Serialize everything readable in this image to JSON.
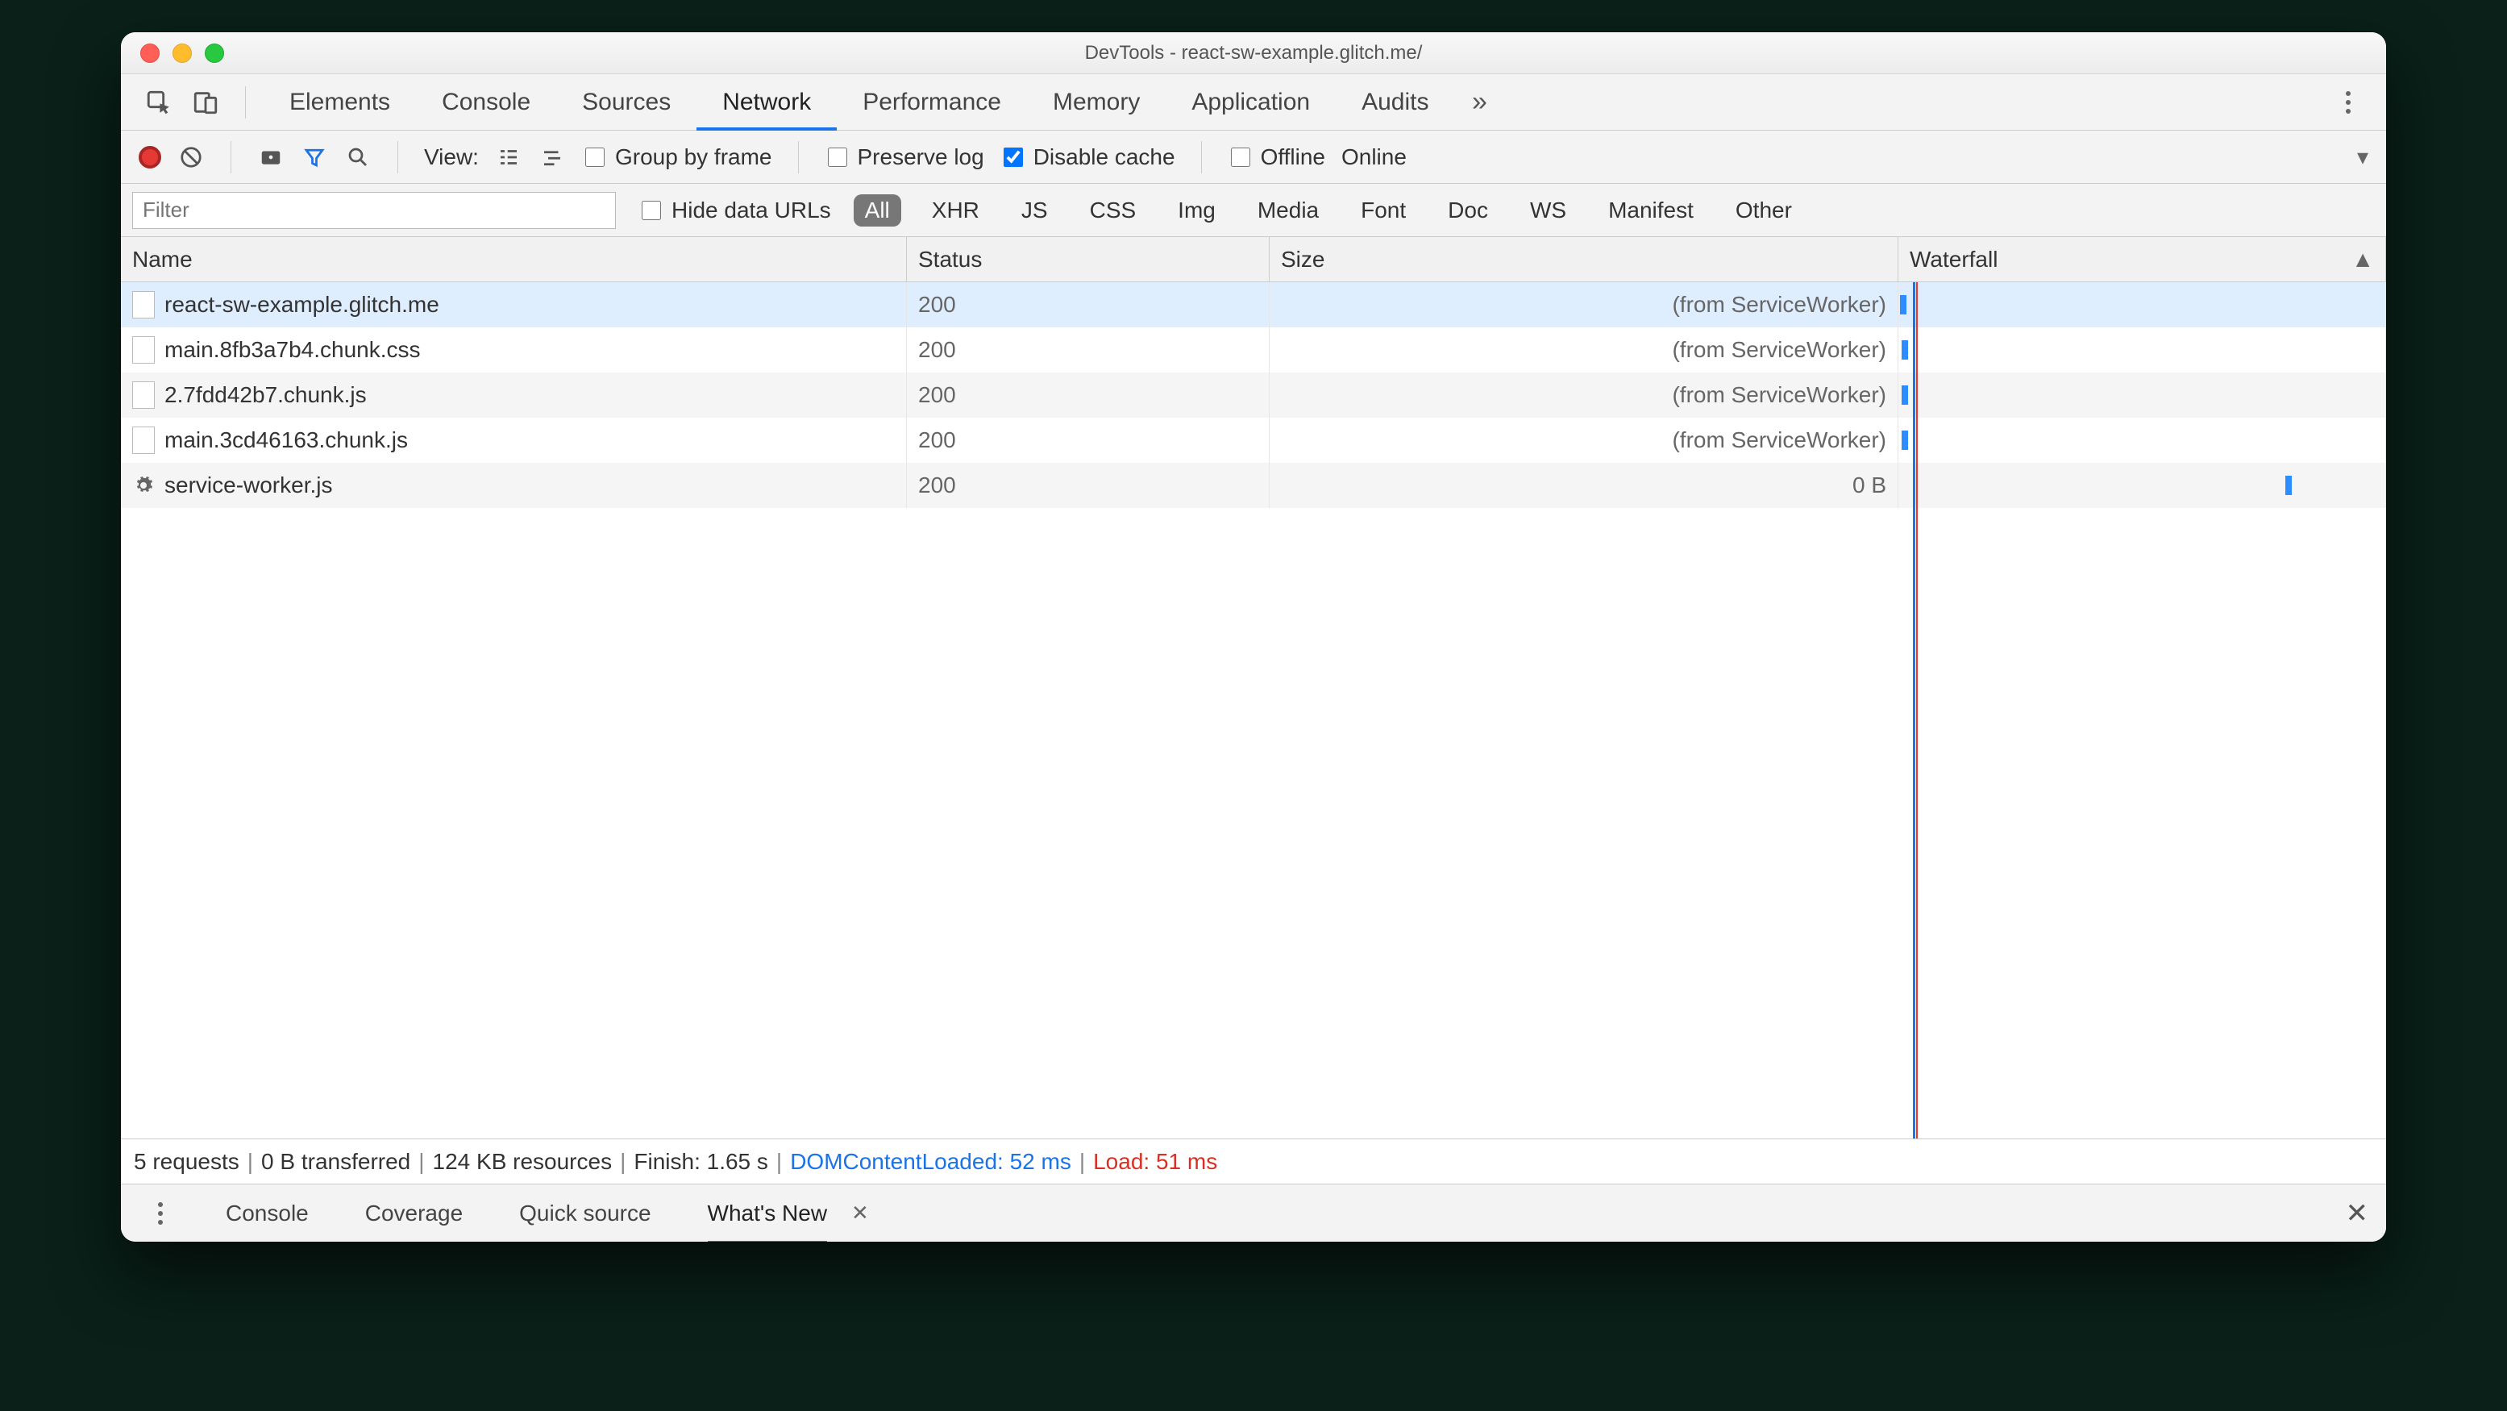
{
  "title": "DevTools - react-sw-example.glitch.me/",
  "mainTabs": [
    "Elements",
    "Console",
    "Sources",
    "Network",
    "Performance",
    "Memory",
    "Application",
    "Audits"
  ],
  "mainTabActive": "Network",
  "toolbar": {
    "viewLabel": "View:",
    "groupByFrame": "Group by frame",
    "preserveLog": "Preserve log",
    "disableCache": "Disable cache",
    "offline": "Offline",
    "online": "Online"
  },
  "filter": {
    "placeholder": "Filter",
    "hideDataUrls": "Hide data URLs",
    "types": [
      "All",
      "XHR",
      "JS",
      "CSS",
      "Img",
      "Media",
      "Font",
      "Doc",
      "WS",
      "Manifest",
      "Other"
    ],
    "typeActive": "All"
  },
  "columns": {
    "name": "Name",
    "status": "Status",
    "size": "Size",
    "waterfall": "Waterfall"
  },
  "rows": [
    {
      "name": "react-sw-example.glitch.me",
      "status": "200",
      "size": "(from ServiceWorker)",
      "icon": "doc",
      "sel": true,
      "wf": 2
    },
    {
      "name": "main.8fb3a7b4.chunk.css",
      "status": "200",
      "size": "(from ServiceWorker)",
      "icon": "doc",
      "wf": 4
    },
    {
      "name": "2.7fdd42b7.chunk.js",
      "status": "200",
      "size": "(from ServiceWorker)",
      "icon": "doc",
      "wf": 4
    },
    {
      "name": "main.3cd46163.chunk.js",
      "status": "200",
      "size": "(from ServiceWorker)",
      "icon": "doc",
      "wf": 4
    },
    {
      "name": "service-worker.js",
      "status": "200",
      "size": "0 B",
      "icon": "gear",
      "wf": 480
    }
  ],
  "waterfall": {
    "redLine": 22,
    "blueLine": 18
  },
  "summary": {
    "requests": "5 requests",
    "transferred": "0 B transferred",
    "resources": "124 KB resources",
    "finish": "Finish: 1.65 s",
    "dcl": "DOMContentLoaded: 52 ms",
    "load": "Load: 51 ms"
  },
  "drawerTabs": [
    "Console",
    "Coverage",
    "Quick source",
    "What's New"
  ],
  "drawerActive": "What's New"
}
